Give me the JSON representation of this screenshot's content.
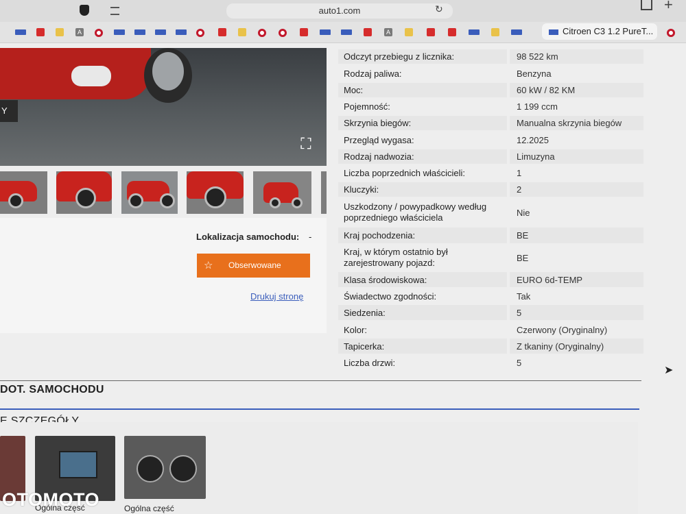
{
  "browser": {
    "url": "auto1.com",
    "active_tab_title": "Citroen C3 1.2 PureT..."
  },
  "gallery": {
    "photo_tag": "Y"
  },
  "location": {
    "label": "Lokalizacja samochodu:",
    "value": "-"
  },
  "actions": {
    "watch_label": "Obserwowane",
    "print_label": "Drukuj stronę"
  },
  "specs": [
    {
      "label": "Odczyt przebiegu z licznika:",
      "value": "98 522 km"
    },
    {
      "label": "Rodzaj paliwa:",
      "value": "Benzyna"
    },
    {
      "label": "Moc:",
      "value": "60 kW / 82 KM"
    },
    {
      "label": "Pojemność:",
      "value": "1 199 ccm"
    },
    {
      "label": "Skrzynia biegów:",
      "value": "Manualna skrzynia biegów"
    },
    {
      "label": "Przegląd wygasa:",
      "value": "12.2025"
    },
    {
      "label": "Rodzaj nadwozia:",
      "value": "Limuzyna"
    },
    {
      "label": "Liczba poprzednich właścicieli:",
      "value": "1"
    },
    {
      "label": "Kluczyki:",
      "value": "2"
    },
    {
      "label": "Uszkodzony / powypadkowy według poprzedniego właściciela",
      "value": "Nie"
    },
    {
      "label": "Kraj pochodzenia:",
      "value": "BE"
    },
    {
      "label": "Kraj, w którym ostatnio był zarejestrowany pojazd:",
      "value": "BE"
    },
    {
      "label": "Klasa środowiskowa:",
      "value": "EURO 6d-TEMP"
    },
    {
      "label": "Świadectwo zgodności:",
      "value": "Tak"
    },
    {
      "label": "Siedzenia:",
      "value": "5"
    },
    {
      "label": "Kolor:",
      "value": "Czerwony (Oryginalny)"
    },
    {
      "label": "Tapicerka:",
      "value": "Z tkaniny (Oryginalny)"
    },
    {
      "label": "Liczba drzwi:",
      "value": "5"
    }
  ],
  "sections": {
    "section1": "DOT. SAMOCHODU",
    "section2": "E SZCZEGÓŁY"
  },
  "bottom_thumbs": {
    "label2": "Ogólna część",
    "label3": "Ogólna część"
  },
  "watermark": "OTOMOTO"
}
